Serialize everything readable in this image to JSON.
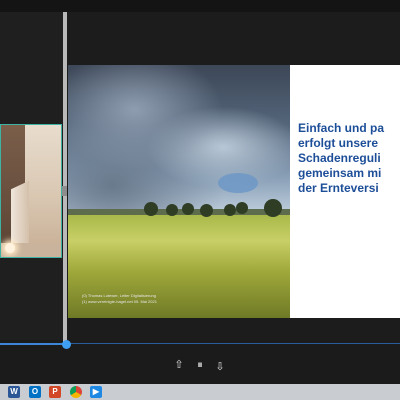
{
  "slide": {
    "headline": "Einfach und pa\nerfolgt unsere\nSchadenreguli\ngemeinsam mi\nder Ernteversi",
    "caption_line1": "(0) Thomas Lutewer, Leiter Digitalisierung",
    "caption_line2": "(1) www.vereinigte-hagel.net   05. Mai 2021"
  },
  "camera": {
    "close_glyph": "×"
  },
  "controls": {
    "prev_glyph": "⇧",
    "pause_glyph": "⏸",
    "next_glyph": "⇧"
  },
  "timeline": {
    "progress_fraction": 0.17
  },
  "taskbar": {
    "icons": [
      {
        "name": "word",
        "glyph": "W",
        "color": "#2b5797"
      },
      {
        "name": "outlook",
        "glyph": "O",
        "color": "#0072c6"
      },
      {
        "name": "powerpoint",
        "glyph": "P",
        "color": "#d24726"
      },
      {
        "name": "chrome",
        "glyph": "",
        "color": "#dd4b39"
      },
      {
        "name": "video-app",
        "glyph": "▶",
        "color": "#1e88e5"
      }
    ]
  },
  "colors": {
    "accent": "#3b86d7",
    "headline": "#1d4e98",
    "camera_border": "#3fb3a3"
  }
}
